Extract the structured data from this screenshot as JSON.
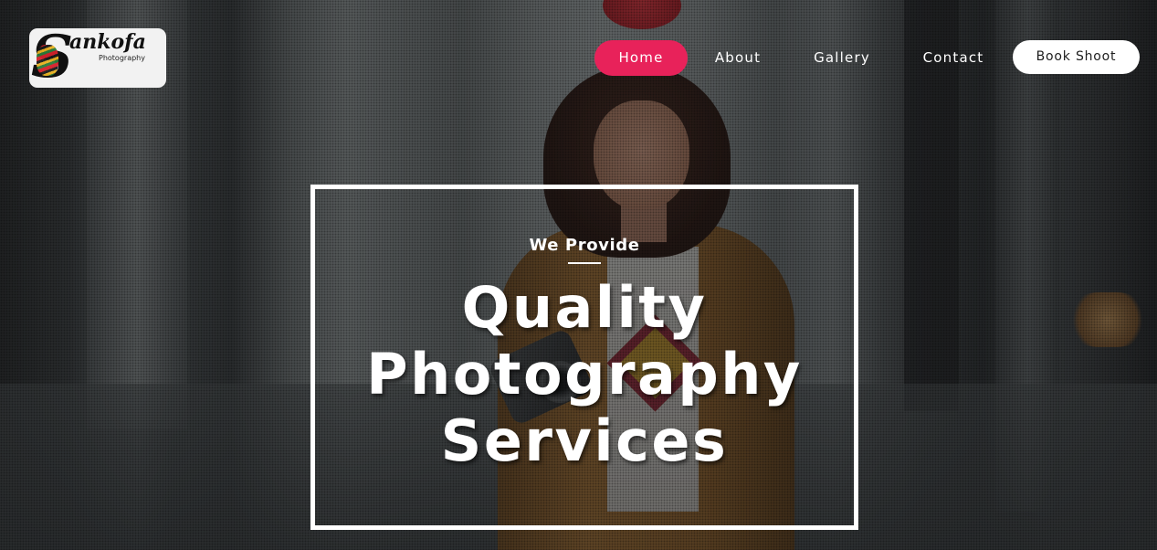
{
  "logo": {
    "brand": "ankofa",
    "mark": "S",
    "subtitle": "Photography"
  },
  "nav": {
    "items": [
      {
        "label": "Home",
        "active": true
      },
      {
        "label": "About",
        "active": false
      },
      {
        "label": "Gallery",
        "active": false
      },
      {
        "label": "Contact",
        "active": false
      }
    ],
    "cta": "Book Shoot"
  },
  "hero": {
    "eyebrow": "We Provide",
    "headline": [
      "Quality",
      "Photography",
      "Services"
    ]
  },
  "colors": {
    "accent": "#e8225a",
    "cta_background": "#ffffff",
    "text": "#ffffff"
  }
}
